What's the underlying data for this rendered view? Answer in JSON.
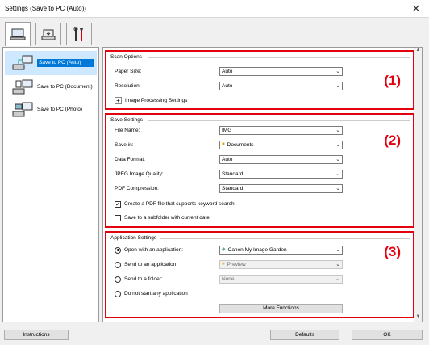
{
  "window": {
    "title": "Settings (Save to PC (Auto))",
    "close_glyph": "✕"
  },
  "toolbar": {
    "tabs": [
      {
        "icon": "computer-scan-icon",
        "active": true
      },
      {
        "icon": "scanner-icon",
        "active": false
      },
      {
        "icon": "tools-icon",
        "active": false
      }
    ]
  },
  "sidebar": {
    "items": [
      {
        "label": "Save to PC (Auto)",
        "selected": true
      },
      {
        "label": "Save to PC (Document)",
        "selected": false
      },
      {
        "label": "Save to PC (Photo)",
        "selected": false
      }
    ]
  },
  "scan_options": {
    "title": "Scan Options",
    "marker": "(1)",
    "paper_size_label": "Paper Size:",
    "paper_size_value": "Auto",
    "resolution_label": "Resolution:",
    "resolution_value": "Auto",
    "image_processing_label": "Image Processing Settings",
    "expand_glyph": "+"
  },
  "save_settings": {
    "title": "Save Settings",
    "marker": "(2)",
    "file_name_label": "File Name:",
    "file_name_value": "IMG",
    "save_in_label": "Save in:",
    "save_in_value": "Documents",
    "data_format_label": "Data Format:",
    "data_format_value": "Auto",
    "jpeg_quality_label": "JPEG Image Quality:",
    "jpeg_quality_value": "Standard",
    "pdf_compression_label": "PDF Compression:",
    "pdf_compression_value": "Standard",
    "keyword_pdf_label": "Create a PDF file that supports keyword search",
    "keyword_pdf_checked": true,
    "check_glyph": "✓",
    "subfolder_label": "Save to a subfolder with current date",
    "subfolder_checked": false
  },
  "application_settings": {
    "title": "Application Settings",
    "marker": "(3)",
    "open_app_label": "Open with an application:",
    "open_app_value": "Canon My Image Garden",
    "send_app_label": "Send to an application:",
    "send_app_value": "Preview",
    "send_folder_label": "Send to a folder:",
    "send_folder_value": "None",
    "no_app_label": "Do not start any application",
    "more_functions_label": "More Functions",
    "selected_option": "open_app"
  },
  "footer": {
    "instructions_label": "Instructions",
    "defaults_label": "Defaults",
    "ok_label": "OK"
  },
  "colors": {
    "highlight_border": "#e3000f",
    "selection": "#0078d7"
  }
}
